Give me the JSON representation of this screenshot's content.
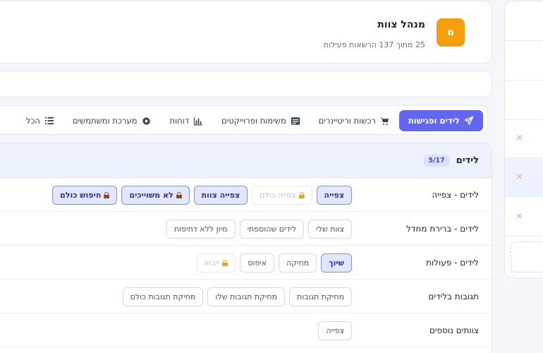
{
  "role": {
    "avatar_letter": "מ",
    "title": "מנהל צוות",
    "subtitle": "25 מתוך 137 הרשאות פעילות",
    "avatar_color": "#f59e0b"
  },
  "search": {
    "value": ""
  },
  "tabs": [
    {
      "label": "לידים ופגישות",
      "icon": "paper-plane-icon",
      "active": true
    },
    {
      "label": "רכשות וריטיינרים",
      "icon": "cart-icon",
      "active": false
    },
    {
      "label": "משימות ופרוייקטים",
      "icon": "card-icon",
      "active": false
    },
    {
      "label": "דוחות",
      "icon": "bar-chart-icon",
      "active": false
    },
    {
      "label": "מערכת ומשתמשים",
      "icon": "gear-icon",
      "active": false
    },
    {
      "label": "הכל",
      "icon": "list-icon",
      "active": false
    }
  ],
  "section": {
    "title": "לידים",
    "count": "5/17"
  },
  "rows": [
    {
      "label": "לידים - צפייה",
      "chips": [
        {
          "label": "צפייה",
          "state": "on",
          "lock": ""
        },
        {
          "label": "צפייה כולם",
          "state": "disabled",
          "lock": "amber"
        },
        {
          "label": "צפייה צוות",
          "state": "on",
          "lock": ""
        },
        {
          "label": "לא משוייכים",
          "state": "on",
          "lock": "brown"
        },
        {
          "label": "חיפוש כולם",
          "state": "on",
          "lock": "brown"
        }
      ]
    },
    {
      "label": "לידים - ברירת מחדל",
      "chips": [
        {
          "label": "צוות שלי",
          "state": "off",
          "lock": ""
        },
        {
          "label": "לידים שהוספתי",
          "state": "off",
          "lock": ""
        },
        {
          "label": "מיון ללא דחיפות",
          "state": "off",
          "lock": ""
        }
      ]
    },
    {
      "label": "לידים - פעולות",
      "chips": [
        {
          "label": "שיוך",
          "state": "on",
          "lock": ""
        },
        {
          "label": "מחיקה",
          "state": "off",
          "lock": ""
        },
        {
          "label": "איפוס",
          "state": "off",
          "lock": ""
        },
        {
          "label": "ייבוא",
          "state": "disabled",
          "lock": "amber"
        }
      ]
    },
    {
      "label": "תגובות בלידים",
      "chips": [
        {
          "label": "מחיקת תגובות",
          "state": "off",
          "lock": ""
        },
        {
          "label": "מחיקת תגובות שלו",
          "state": "off",
          "lock": ""
        },
        {
          "label": "מחיקת תגובות כולם",
          "state": "off",
          "lock": ""
        }
      ]
    },
    {
      "label": "צוותים נוספים",
      "chips": [
        {
          "label": "צפייה",
          "state": "off",
          "lock": ""
        }
      ]
    }
  ],
  "side_panel": {
    "remove_symbol": "×",
    "remove_color": "#f3a1ad",
    "active_item": 4
  }
}
